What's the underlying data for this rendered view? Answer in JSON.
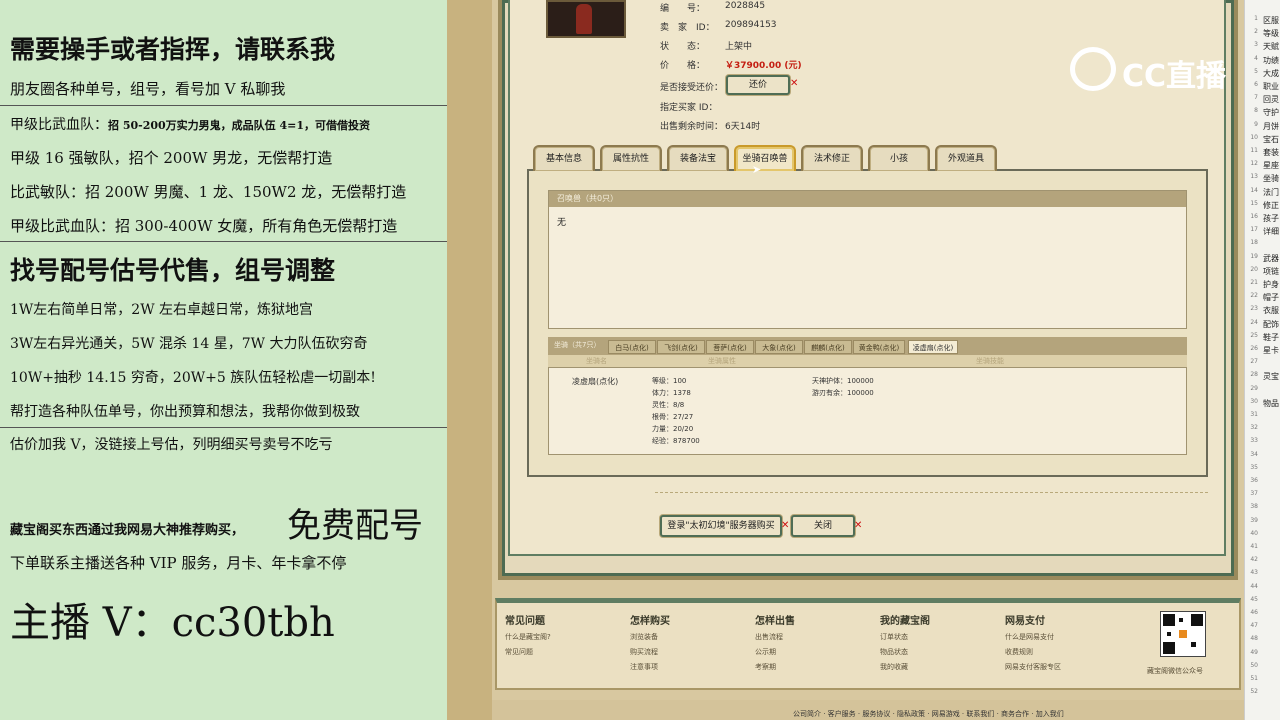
{
  "left": {
    "l1": "需要操手或者指挥，请联系我",
    "l2": "朋友圈各种单号，组号，看号加 V 私聊我",
    "l3a": "甲级比武血队：",
    "l3b": "招 50-200万实力男鬼，成品队伍 4=1，可借借投资",
    "l4": "甲级 16 强敏队，招个 200W 男龙，无偿帮打造",
    "l5": "比武敏队：招 200W 男魔、1 龙、150W2 龙，无偿帮打造",
    "l6": "甲级比武血队：招 300-400W 女魔，所有角色无偿帮打造",
    "l7": "找号配号估号代售，组号调整",
    "l8": "1W左右简单日常，2W 左右卓越日常，炼狱地宫",
    "l9": "3W左右异光通关，5W 混杀 14 星，7W 大力队伍砍穷奇",
    "l10": "10W+抽秒 14.15 穷奇，20W+5 族队伍轻松虐一切副本!",
    "l11": "帮打造各种队伍单号，你出预算和想法，我帮你做到极致",
    "l12": "估价加我 V，没链接上号估，列明细买号卖号不吃亏",
    "l13a": "藏宝阁买东西通过我网易大神推荐购买，",
    "l13b": "免费配号",
    "l14": "下单联系主播送各种 VIP 服务，月卡、年卡拿不停",
    "l15": "主播 V：cc30tbh"
  },
  "item": {
    "id_label": "编　　号：",
    "id_value": "2028845",
    "seller_label": "卖　家　ID：",
    "seller_value": "209894153",
    "status_label": "状　　态：",
    "status_value": "上架中",
    "price_label": "价　　格：",
    "price_value": "￥37900.00 (元)",
    "bargain_label": "是否接受还价：",
    "bargain_btn": "还价",
    "buyer_label": "指定买家 ID：",
    "time_label": "出售剩余时间：",
    "time_value": "6天14时"
  },
  "tabs": [
    "基本信息",
    "属性抗性",
    "装备法宝",
    "坐骑召唤兽",
    "法术修正",
    "小孩",
    "外观道具"
  ],
  "active_tab": 3,
  "pets": {
    "header": "召唤兽（共0只）",
    "empty": "无"
  },
  "mounts": {
    "header": "坐骑（共7只）",
    "tabs": [
      "白马(点化)",
      "飞剑(点化)",
      "菩萨(点化)",
      "大象(点化)",
      "麒麟(点化)",
      "黄金鸭(点化)",
      "凌虚扇(点化)"
    ],
    "col1": "坐骑名",
    "col2": "坐骑属性",
    "col3": "坐骑技能",
    "name": "凌虚扇(点化)",
    "stats": [
      "等级：100",
      "体力：1378",
      "灵性：8/8",
      "根骨：27/27",
      "力量：20/20",
      "经验：878700"
    ],
    "skills": [
      "天神护体：100000",
      "游刃有余：100000"
    ]
  },
  "actions": {
    "login": "登录\"太初幻境\"服务器购买",
    "close": "关闭"
  },
  "footer": {
    "cols": [
      {
        "title": "常见问题",
        "links": [
          "什么是藏宝阁?",
          "常见问题"
        ]
      },
      {
        "title": "怎样购买",
        "links": [
          "浏览装备",
          "购买流程",
          "注意事项"
        ]
      },
      {
        "title": "怎样出售",
        "links": [
          "出售流程",
          "公示期",
          "考察期"
        ]
      },
      {
        "title": "我的藏宝阁",
        "links": [
          "订单状态",
          "物品状态",
          "我的收藏"
        ]
      },
      {
        "title": "网易支付",
        "links": [
          "什么是网易支付",
          "收费规则",
          "网易支付客服专区"
        ]
      }
    ],
    "qr_caption": "藏宝阁微信公众号",
    "bottom_links": "公司简介 · 客户服务 · 服务协议 · 隐私政策 · 网易游戏 · 联系我们 · 商务合作 · 加入我们"
  },
  "watermark": "CC直播",
  "right_panel": {
    "nums": [
      "1",
      "2",
      "3",
      "4",
      "5",
      "6",
      "7",
      "8",
      "9",
      "10",
      "11",
      "12",
      "13",
      "14",
      "15",
      "16",
      "17",
      "18",
      "19",
      "20",
      "21",
      "22",
      "23",
      "24",
      "25",
      "26",
      "27",
      "28",
      "29",
      "30",
      "31",
      "32",
      "33",
      "34",
      "35",
      "36",
      "37",
      "38",
      "39",
      "40",
      "41",
      "42",
      "43",
      "44",
      "45",
      "46",
      "47",
      "48",
      "49",
      "50",
      "51",
      "52"
    ],
    "texts": [
      "区服",
      "等级",
      "天赋",
      "功绩",
      "大成",
      "职业",
      "回灵",
      "守护",
      "月饼",
      "宝石",
      "套装",
      "星座",
      "坐骑",
      "法门",
      "修正",
      "孩子",
      "详细",
      "",
      "武器",
      "项链",
      "护身",
      "帽子",
      "衣服",
      "配饰",
      "鞋子",
      "星卡",
      "",
      "灵宝",
      "",
      "物品"
    ]
  }
}
